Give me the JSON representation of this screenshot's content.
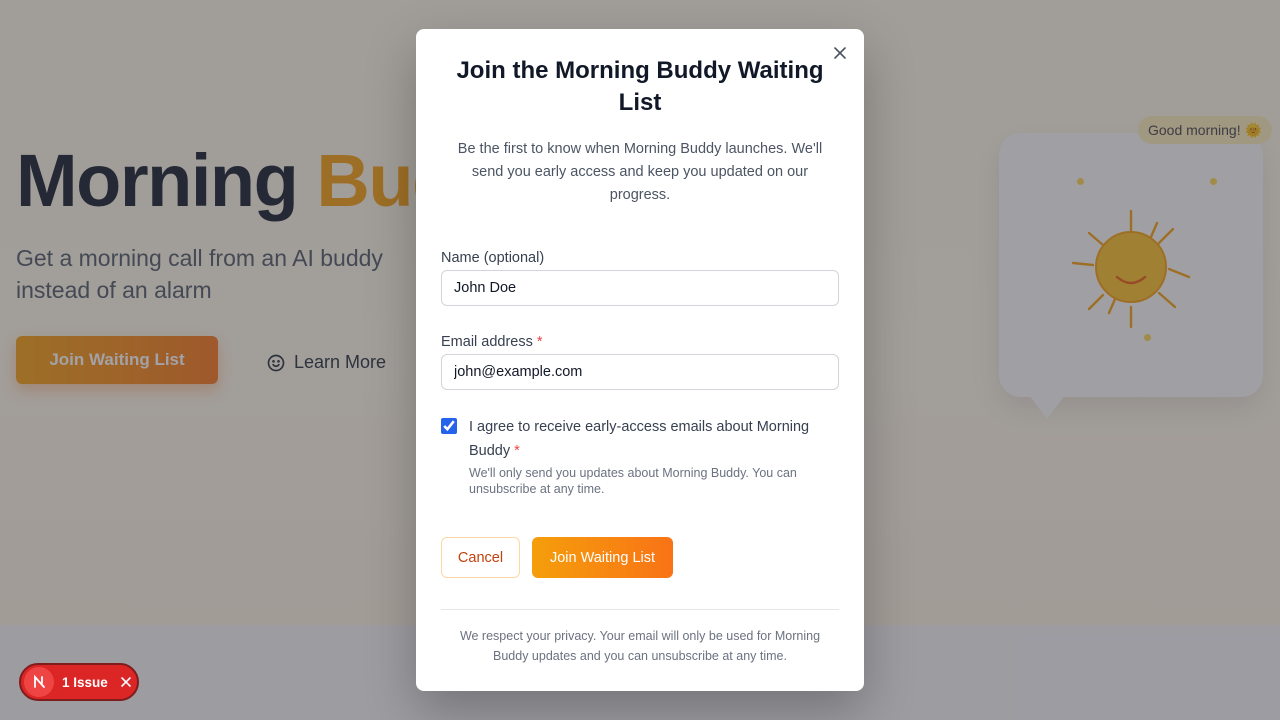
{
  "hero": {
    "title_part1": "Morning ",
    "title_part2": "Buddy",
    "subtitle": "Get a morning call from an AI buddy instead of an alarm",
    "cta_label": "Join Waiting List",
    "learn_more_label": "Learn More",
    "greeting_bubble": "Good morning! 🌞"
  },
  "modal": {
    "title": "Join the Morning Buddy Waiting List",
    "description": "Be the first to know when Morning Buddy launches. We'll send you early access and keep you updated on our progress.",
    "name_label": "Name (optional)",
    "name_value": "John Doe",
    "email_label": "Email address",
    "required_mark": "*",
    "email_value": "john@example.com",
    "consent_label": "I agree to receive early-access emails about Morning Buddy",
    "consent_checked": true,
    "consent_help": "We'll only send you updates about Morning Buddy. You can unsubscribe at any time.",
    "cancel_label": "Cancel",
    "submit_label": "Join Waiting List",
    "privacy_note": "We respect your privacy. Your email will only be used for Morning Buddy updates and you can unsubscribe at any time."
  },
  "dev_badge": {
    "issues_label": "1 Issue"
  },
  "colors": {
    "accent": "#f59e0b",
    "accent_end": "#f97316",
    "required": "#ef4444",
    "issue_badge": "#dc2626"
  },
  "icons": [
    "close-icon",
    "smile-icon",
    "sun-icon",
    "nextjs-logo-icon",
    "x-icon"
  ]
}
